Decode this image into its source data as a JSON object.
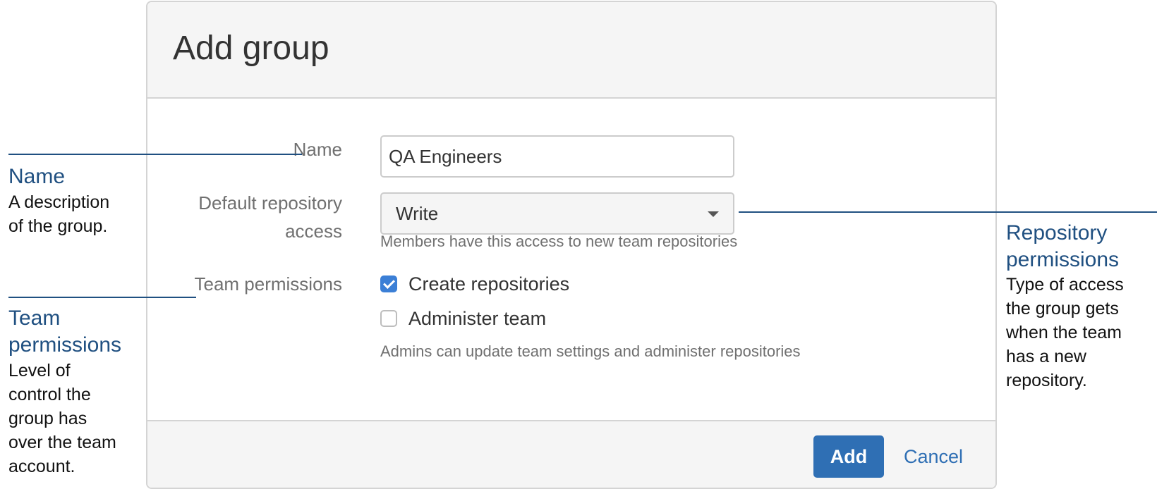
{
  "dialog": {
    "title": "Add group",
    "name_label": "Name",
    "name_value": "QA Engineers",
    "repo_access_label_line1": "Default repository",
    "repo_access_label_line2": "access",
    "repo_access_value": "Write",
    "repo_access_help": "Members have this access to new team repositories",
    "team_permissions_label": "Team permissions",
    "permissions": [
      {
        "label": "Create repositories",
        "checked": true
      },
      {
        "label": "Administer team",
        "checked": false
      }
    ],
    "permissions_help": "Admins can update team settings and administer repositories",
    "add_button": "Add",
    "cancel_link": "Cancel"
  },
  "callouts": {
    "name": {
      "title": "Name",
      "lines": [
        "A description",
        "of the group."
      ]
    },
    "team": {
      "title_lines": [
        "Team",
        "permissions"
      ],
      "lines": [
        "Level of",
        "control the",
        "group has",
        "over the team",
        "account."
      ]
    },
    "repo": {
      "title_lines": [
        "Repository",
        "permissions"
      ],
      "lines": [
        "Type of access",
        "the group gets",
        "when the team",
        "has a new",
        "repository."
      ]
    }
  },
  "colors": {
    "accent": "#2f6fb4",
    "callout": "#205081",
    "checkbox_checked": "#3b7fd6"
  },
  "icons": {
    "dropdown": "chevron-down-icon",
    "checkbox_checked": "checkmark-icon"
  }
}
